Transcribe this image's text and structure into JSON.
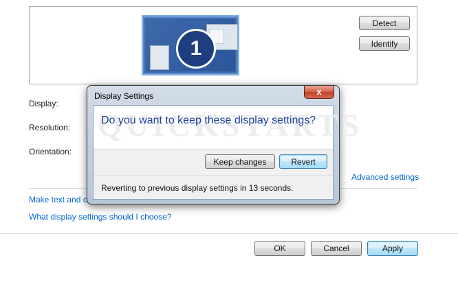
{
  "preview": {
    "monitor_number": "1",
    "detect_label": "Detect",
    "identify_label": "Identify"
  },
  "settings": {
    "display_label": "Display:",
    "resolution_label": "Resolution:",
    "orientation_label": "Orientation:",
    "advanced_link": "Advanced settings",
    "make_text_link": "Make text and ot",
    "what_settings_link": "What display settings should I choose?"
  },
  "footer": {
    "ok_label": "OK",
    "cancel_label": "Cancel",
    "apply_label": "Apply"
  },
  "dialog": {
    "title": "Display Settings",
    "close_glyph": "x",
    "watermark": "QUICKSTARTS",
    "question": "Do you want to keep these display settings?",
    "keep_label": "Keep changes",
    "revert_label": "Revert",
    "status": "Reverting to previous display settings in 13 seconds."
  },
  "colors": {
    "link": "#0066cc",
    "question": "#1d3fa0",
    "monitor_blue": "#3e6aa6"
  }
}
